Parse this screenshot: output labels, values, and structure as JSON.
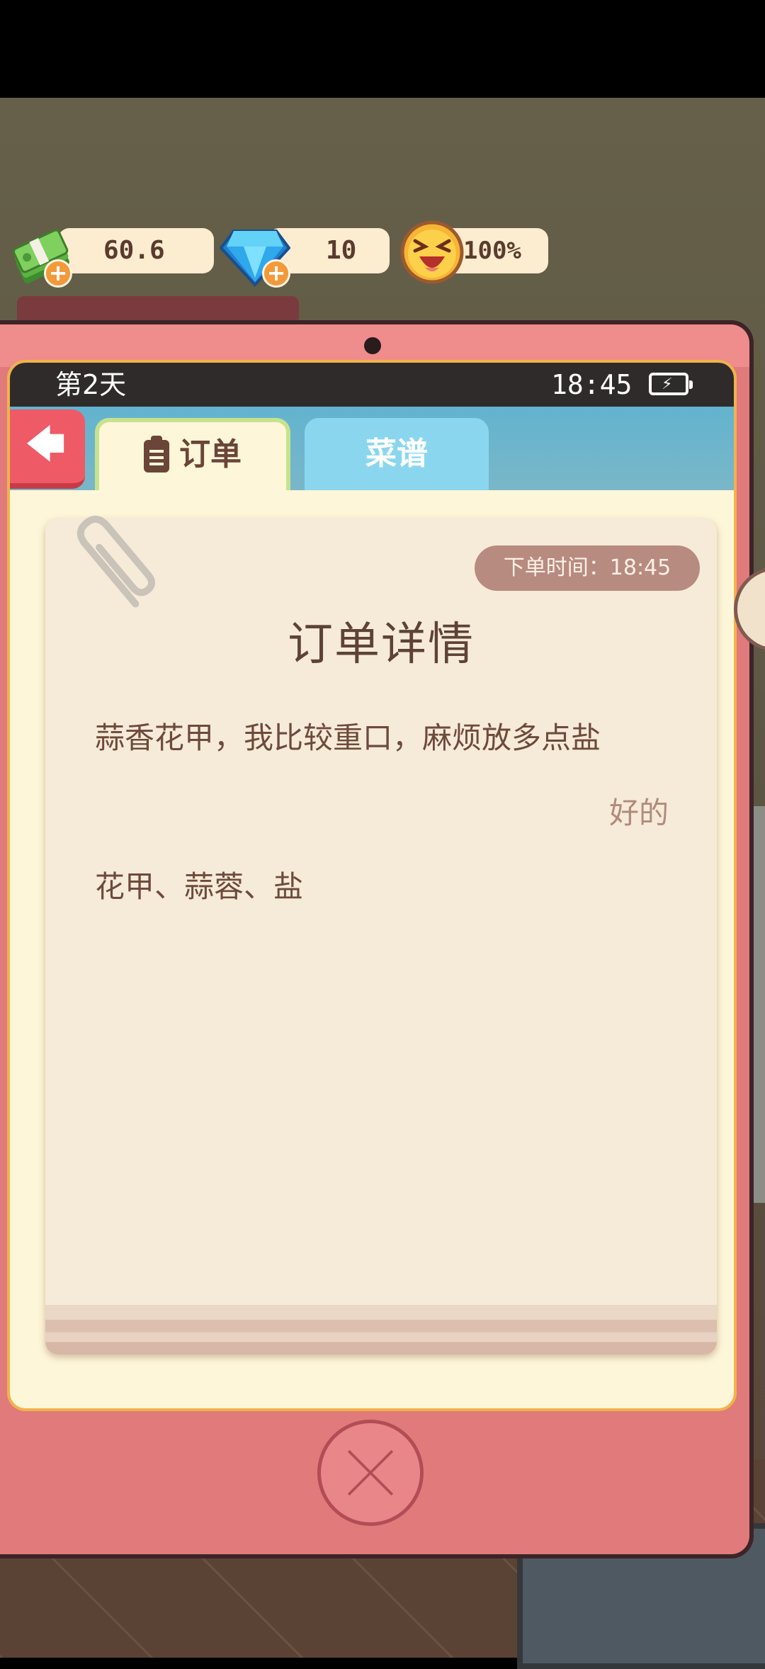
{
  "resources": {
    "money": "60.6",
    "gems": "10",
    "mood": "100%"
  },
  "device": {
    "day": "第2天",
    "clock": "18:45"
  },
  "tabs": [
    {
      "label": "订单",
      "active": true
    },
    {
      "label": "菜谱",
      "active": false
    }
  ],
  "order": {
    "time_label": "下单时间：18:45",
    "title": "订单详情",
    "request": "蒜香花甲，我比较重口，麻烦放多点盐",
    "reply": "好的",
    "ingredients": "花甲、蒜蓉、盐"
  },
  "colors": {
    "tablet": "#e07a7b",
    "screen": "#fef6d9",
    "card": "#f6ebd8",
    "tab_active_border": "#c7e28e",
    "tab_inactive": "#8ad6ef",
    "back_button": "#ef5a67"
  },
  "icons": [
    "cash-stack-icon",
    "diamond-icon",
    "laughing-face-icon",
    "plus-icon",
    "battery-charging-icon",
    "back-arrow-icon",
    "clipboard-icon",
    "paperclip-icon",
    "close-x-icon"
  ]
}
